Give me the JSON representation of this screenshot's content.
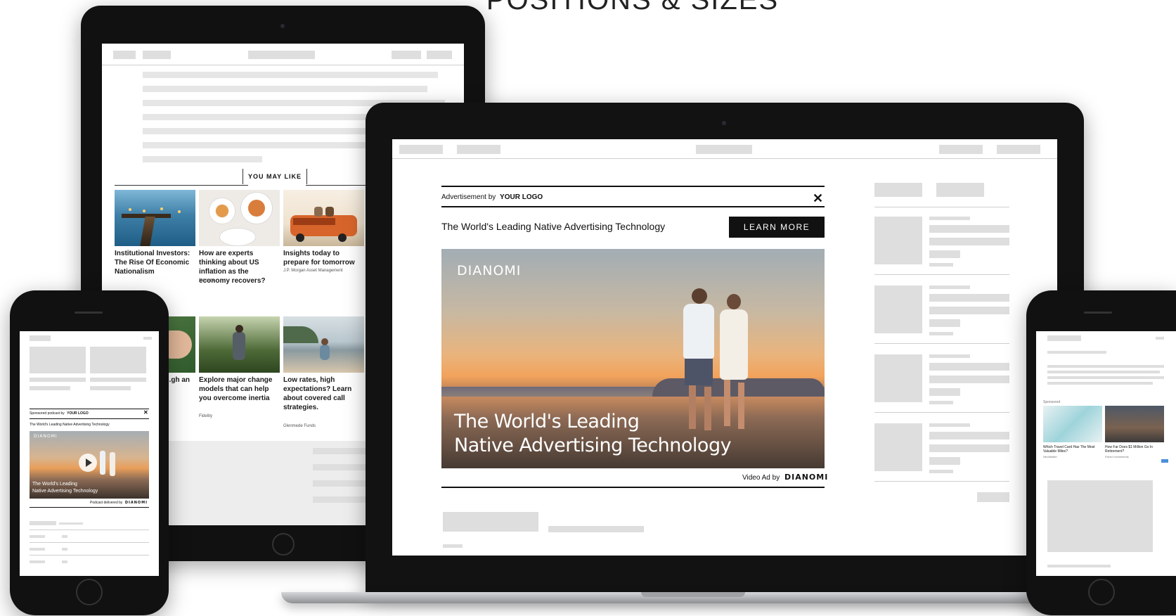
{
  "headline": "POSITIONS & SIZES",
  "laptop": {
    "ad_header": {
      "prefix": "Advertisement by",
      "logo": "YOUR LOGO",
      "close_glyph": "✕"
    },
    "ad_headline": "The World's Leading Native Advertising Technology",
    "cta_label": "LEARN MORE",
    "video": {
      "brand": "DIANOMI",
      "overlay_line1": "The World's Leading",
      "overlay_line2": "Native Advertising Technology"
    },
    "video_credit_prefix": "Video Ad by",
    "video_credit_brand": "DIANOMI"
  },
  "tablet": {
    "section_label": "YOU MAY LIKE",
    "articles": [
      {
        "title": "Institutional Investors: The Rise Of Economic Nationalism",
        "source": ""
      },
      {
        "title": "How are experts thinking about US inflation as the economy recovers?",
        "source": "Nomura"
      },
      {
        "title": "Insights today to prepare for tomorrow",
        "source": "J.P. Morgan Asset Management"
      },
      {
        "title": "...gh an",
        "source": ""
      },
      {
        "title": "Explore major change models that can help you overcome inertia",
        "source": "Fidelity"
      },
      {
        "title": "Low rates, high expectations? Learn about covered call strategies.",
        "source": "Glenmede Funds"
      }
    ]
  },
  "phone_left": {
    "sponsored_prefix": "Sponsored podcast by",
    "logo": "YOUR LOGO",
    "close_glyph": "✕",
    "ad_headline": "The World's Leading Native Advertising Technology",
    "video_brand": "DIANOMI",
    "overlay_line1": "The World's Leading",
    "overlay_line2": "Native Advertising Technology",
    "credit_prefix": "Podcast delivered by",
    "credit_brand": "DIANOMI"
  },
  "phone_right": {
    "sponsored_label": "Sponsored",
    "cards": [
      {
        "title": "Which Travel Card Has The Most Valuable Miles?",
        "source": "NerdWallet"
      },
      {
        "title": "How Far Does $1 Million Go In Retirement?",
        "source": "Fisher Investments"
      }
    ]
  },
  "icons": {
    "close": "close-icon",
    "play": "play-icon"
  },
  "colors": {
    "cta_background": "#111111",
    "device_bezel": "#111111",
    "placeholder": "#dedede"
  }
}
